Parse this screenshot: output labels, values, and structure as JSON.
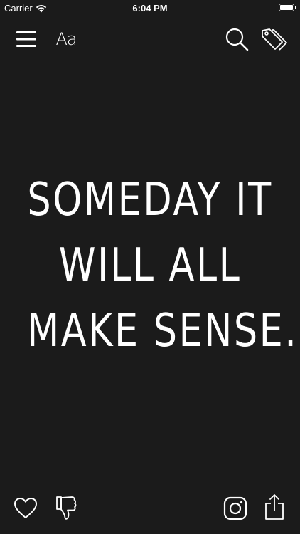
{
  "status_bar": {
    "carrier": "Carrier",
    "time": "6:04 PM",
    "battery_level": 1.0
  },
  "toolbar": {
    "font_label": "Aa",
    "icons": [
      "menu-icon",
      "search-icon",
      "tag-icon"
    ]
  },
  "quote": {
    "lines": [
      "SOMEDAY IT",
      "WILL ALL",
      "MAKE SENSE."
    ]
  },
  "bottom_bar": {
    "icons": [
      "heart-icon",
      "thumbs-down-icon",
      "instagram-icon",
      "share-icon"
    ]
  },
  "colors": {
    "background": "#1b1b1b",
    "foreground": "#ffffff"
  }
}
